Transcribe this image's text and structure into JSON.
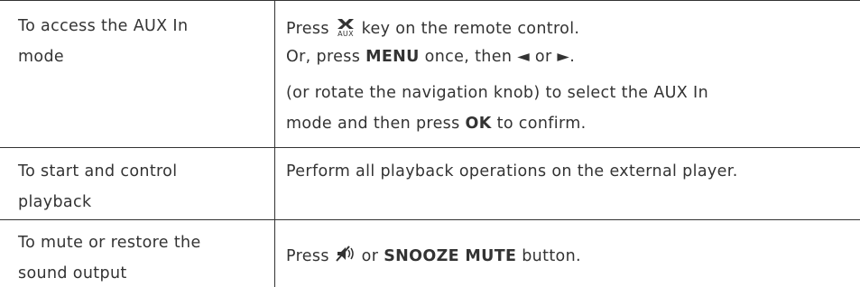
{
  "rows": [
    {
      "action_lines": [
        "To access the AUX In",
        "mode"
      ],
      "desc": {
        "line1_pre": "Press",
        "line1_icon": "aux-input-icon",
        "line1_icon_label": "AUX",
        "line1_post": "key on the remote control.",
        "line2_pre": "Or, press",
        "line2_bold": "MENU",
        "line2_post": "once, then ◄ or ►.",
        "line3": "(or rotate the navigation knob) to select the AUX In",
        "line4_pre": "mode and then press",
        "line4_bold": "OK",
        "line4_post": "to confirm."
      }
    },
    {
      "action_lines": [
        "To start and control",
        "playback"
      ],
      "desc": {
        "line1": "Perform all playback operations on the external player."
      }
    },
    {
      "action_lines": [
        "To mute or restore the",
        "sound output"
      ],
      "desc": {
        "line1_pre": "Press",
        "line1_icon": "mute-icon",
        "line1_mid": "or",
        "line1_bold": "SNOOZE MUTE",
        "line1_post": "button."
      }
    }
  ]
}
